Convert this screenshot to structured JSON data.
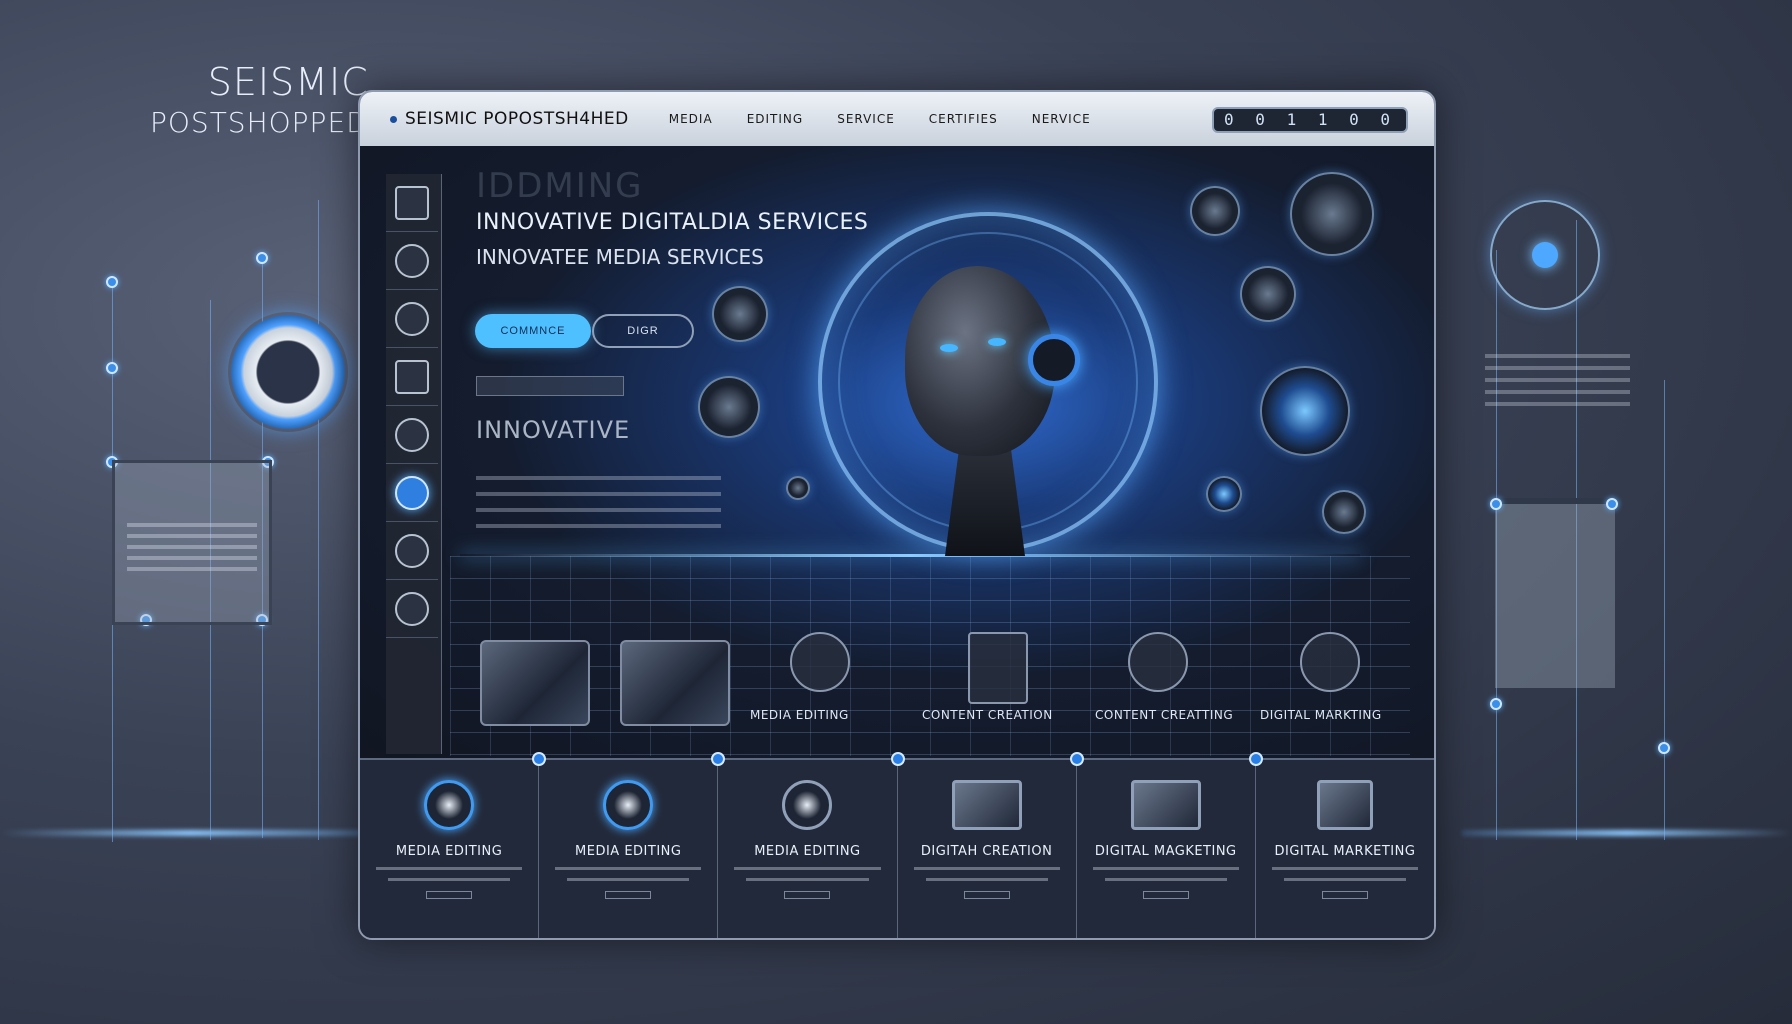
{
  "side_brand": {
    "line1": "SEISMIC",
    "line2": "POSTSHOPPED"
  },
  "topbar": {
    "brand": "SEISMIC POPOSTSH4HED",
    "nav": [
      "MEDIA",
      "EDITING",
      "SERVICE",
      "CERTIFIES",
      "NERVICE"
    ],
    "counter": "0 0 1 1 0 0"
  },
  "hero": {
    "ghost_word": "IDDMING",
    "title_line1": "INNOVATIVE DIGITALDIA SERVICES",
    "title_line2": "INNOVATEE MEDIA SERVICES",
    "primary_button": "COMMNCE",
    "secondary_button": "DIGR",
    "subtitle": "INNOVATIVE"
  },
  "mid_labels": [
    "MEDIA EDITING",
    "CONTENT CREATION",
    "CONTENT CREATTING",
    "DIGITAL MARKTING"
  ],
  "cards": [
    {
      "label": "MEDIA EDITING"
    },
    {
      "label": "MEDIA EDITING"
    },
    {
      "label": "MEDIA EDITING"
    },
    {
      "label": "DIGITAH CREATION"
    },
    {
      "label": "DIGITAL MAGKETING"
    },
    {
      "label": "DIGITAL MARKETING"
    }
  ],
  "colors": {
    "accent": "#4fc0ff",
    "glow": "#5ab4ff",
    "window_bg": "#1c2230"
  }
}
